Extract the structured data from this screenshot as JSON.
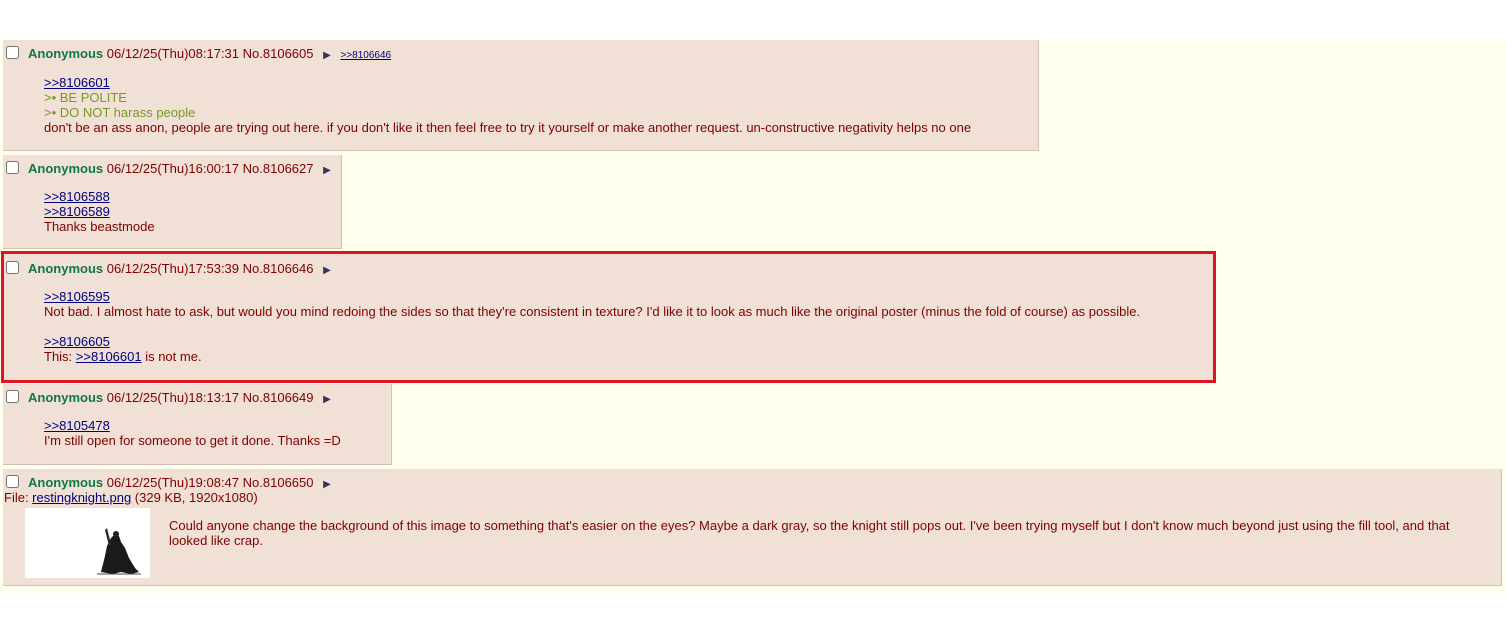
{
  "posts": [
    {
      "name": "Anonymous",
      "datetime": "06/12/25(Thu)08:17:31",
      "number": "No.8106605",
      "arrow": "▶",
      "backlink": ">>8106646",
      "lines": {
        "reply": ">>8106601",
        "green1": ">• BE POLITE",
        "green2": ">• DO NOT harass people",
        "text": "don't be an ass anon, people are trying out here. if you don't like it then feel free to try it yourself or make another request. un-constructive negativity helps no one"
      }
    },
    {
      "name": "Anonymous",
      "datetime": "06/12/25(Thu)16:00:17",
      "number": "No.8106627",
      "arrow": "▶",
      "lines": {
        "reply1": ">>8106588",
        "reply2": ">>8106589",
        "text": "Thanks beastmode"
      }
    },
    {
      "name": "Anonymous",
      "datetime": "06/12/25(Thu)17:53:39",
      "number": "No.8106646",
      "arrow": "▶",
      "lines": {
        "reply1": ">>8106595",
        "text1": "Not bad. I almost hate to ask, but would you mind redoing the sides so that they're consistent in texture? I'd like it to look as much like the original poster (minus the fold of course) as possible.",
        "reply2": ">>8106605",
        "text2_prefix": "This: ",
        "text2_link": ">>8106601",
        "text2_suffix": " is not me."
      }
    },
    {
      "name": "Anonymous",
      "datetime": "06/12/25(Thu)18:13:17",
      "number": "No.8106649",
      "arrow": "▶",
      "lines": {
        "reply": ">>8105478",
        "text": "I'm still open for someone to get it done. Thanks =D"
      }
    },
    {
      "name": "Anonymous",
      "datetime": "06/12/25(Thu)19:08:47",
      "number": "No.8106650",
      "arrow": "▶",
      "file": {
        "label": "File: ",
        "filename": "restingknight.png",
        "meta": " (329 KB, 1920x1080)"
      },
      "text": "Could anyone change the background of this image to something that's easier on the eyes? Maybe a dark gray, so the knight still pops out. I've been trying myself but I don't know much beyond just using the fill tool, and that looked like crap."
    }
  ],
  "colors": {
    "post_bg": "#f0e0d6",
    "board_bg": "#ffffee",
    "name": "#117743",
    "text": "#800000",
    "link": "#000080",
    "greentext": "#789922",
    "highlight": "#e0141e"
  }
}
